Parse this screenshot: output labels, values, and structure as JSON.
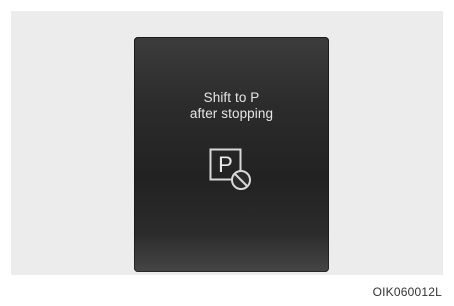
{
  "display": {
    "message_line1": "Shift to P",
    "message_line2": "after stopping",
    "icon": "park-prohibited-icon",
    "icon_letter": "P"
  },
  "figure_code": "OIK060012L"
}
